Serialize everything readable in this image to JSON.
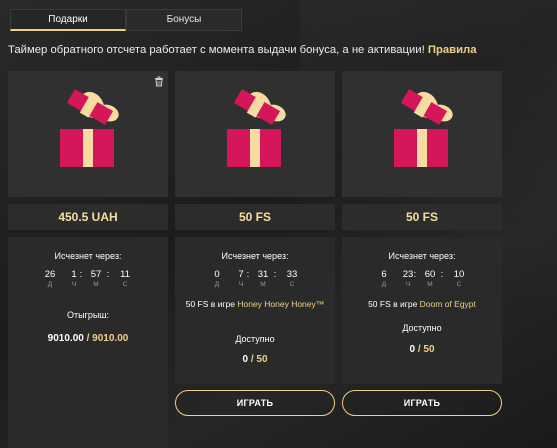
{
  "tabs": {
    "gifts": "Подарки",
    "bonuses": "Бонусы"
  },
  "notice": {
    "text": "Таймер обратного отсчета работает с момента выдачи бонуса, а не активации!",
    "rules_link": "Правила"
  },
  "colors": {
    "accent": "#f0cf86",
    "gift_red": "#d6165b",
    "gift_ribbon": "#f6dca0"
  },
  "cards": [
    {
      "value": "450.5 UAH",
      "expire_label": "Исчезнет через:",
      "timer": {
        "d": "26",
        "h": "1",
        "m": "57",
        "s": "11"
      },
      "units": {
        "d": "Д",
        "h": "Ч",
        "m": "М",
        "s": "С"
      },
      "wagering_label": "Отыгрыш:",
      "wagering_current": "9010.00",
      "wagering_sep": " / ",
      "wagering_total": "9010.00",
      "icons": {
        "trash": "trash-icon",
        "gift": "gift-icon"
      }
    },
    {
      "value": "50 FS",
      "expire_label": "Исчезнет через:",
      "timer": {
        "d": "0",
        "h": "7",
        "m": "31",
        "s": "33"
      },
      "units": {
        "d": "Д",
        "h": "Ч",
        "m": "М",
        "s": "С"
      },
      "fs_prefix": "50 FS в игре ",
      "game": "Honey Honey Honey™",
      "available_label": "Доступно",
      "available_current": "0",
      "available_sep": " / ",
      "available_total": "50",
      "play_label": "ИГРАТЬ"
    },
    {
      "value": "50 FS",
      "expire_label": "Исчезнет через:",
      "timer": {
        "d": "6",
        "h": "23",
        "m": "60",
        "s": "10"
      },
      "units": {
        "d": "Д",
        "h": "Ч",
        "m": "М",
        "s": "С"
      },
      "fs_prefix": "50 FS в игре ",
      "game": "Doom of Egypt",
      "available_label": "Доступно",
      "available_current": "0",
      "available_sep": " / ",
      "available_total": "50",
      "play_label": "ИГРАТЬ"
    }
  ]
}
